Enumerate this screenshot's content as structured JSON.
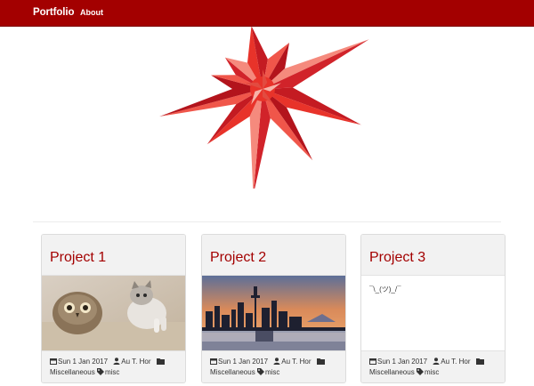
{
  "navbar": {
    "brand": "Portfolio",
    "links": [
      {
        "label": "About"
      }
    ]
  },
  "logo": {
    "icon": "spikey-star-logo-icon",
    "color": "#e8332a"
  },
  "projects": [
    {
      "title": "Project 1",
      "image": "owl-and-kitten-photo",
      "date": "Sun 1 Jan 2017",
      "author": "Au T. Hor",
      "category": "Miscellaneous",
      "tag": "misc"
    },
    {
      "title": "Project 2",
      "image": "city-skyline-at-sunset-photo",
      "date": "Sun 1 Jan 2017",
      "author": "Au T. Hor",
      "category": "Miscellaneous",
      "tag": "misc"
    },
    {
      "title": "Project 3",
      "text": "¯\\_(ツ)_/¯",
      "date": "Sun 1 Jan 2017",
      "author": "Au T. Hor",
      "category": "Miscellaneous",
      "tag": "misc"
    }
  ],
  "colors": {
    "nav": "#a30000",
    "accent": "#a30000",
    "card_bg": "#f2f2f2"
  }
}
